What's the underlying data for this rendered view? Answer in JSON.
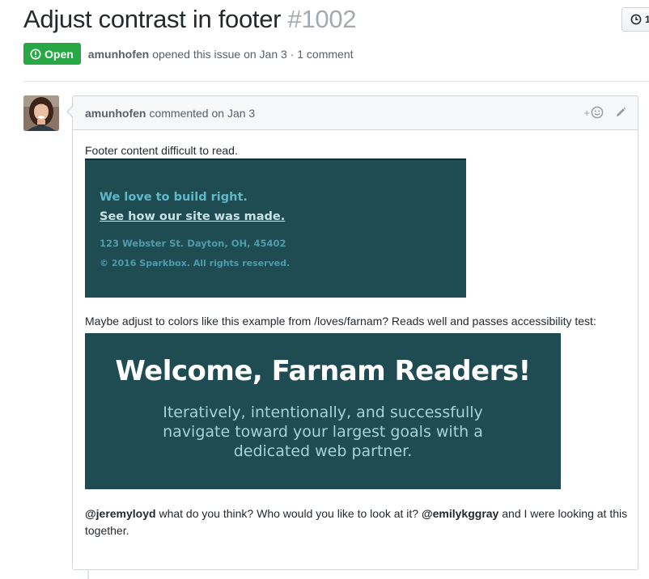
{
  "issue": {
    "title": "Adjust contrast in footer",
    "number": "#1002",
    "state": "Open",
    "author": "amunhofen",
    "meta": "opened this issue on Jan 3 · 1 comment"
  },
  "history_button": {
    "label": "1"
  },
  "comment": {
    "author": "amunhofen",
    "meta": "commented on Jan 3",
    "reaction_plus": "+",
    "text1": "Footer content difficult to read.",
    "image1": {
      "line1": "We love to build right.",
      "line2": "See how our site was made.",
      "line3": "123 Webster St. Dayton, OH, 45402",
      "line4": "© 2016 Sparkbox. All rights reserved."
    },
    "text2": "Maybe adjust to colors like this example from /loves/farnam? Reads well and passes accessibility test:",
    "image2": {
      "title": "Welcome, Farnam Readers!",
      "sub1": "Iteratively, intentionally, and successfully",
      "sub2": "navigate toward your largest goals with a",
      "sub3": "dedicated web partner."
    },
    "text3": {
      "mention1": "@jeremyloyd",
      "part1": " what do you think? Who would you like to look at it? ",
      "mention2": "@emilykggray",
      "part2": " and I were looking at this together."
    }
  },
  "colors": {
    "open_green": "#28a745",
    "image_teal": "#1f4b52",
    "muted_text": "#586069",
    "border": "#d1d5da"
  },
  "icons": [
    "clock-icon",
    "issue-opened-icon",
    "smiley-icon",
    "pencil-icon"
  ]
}
